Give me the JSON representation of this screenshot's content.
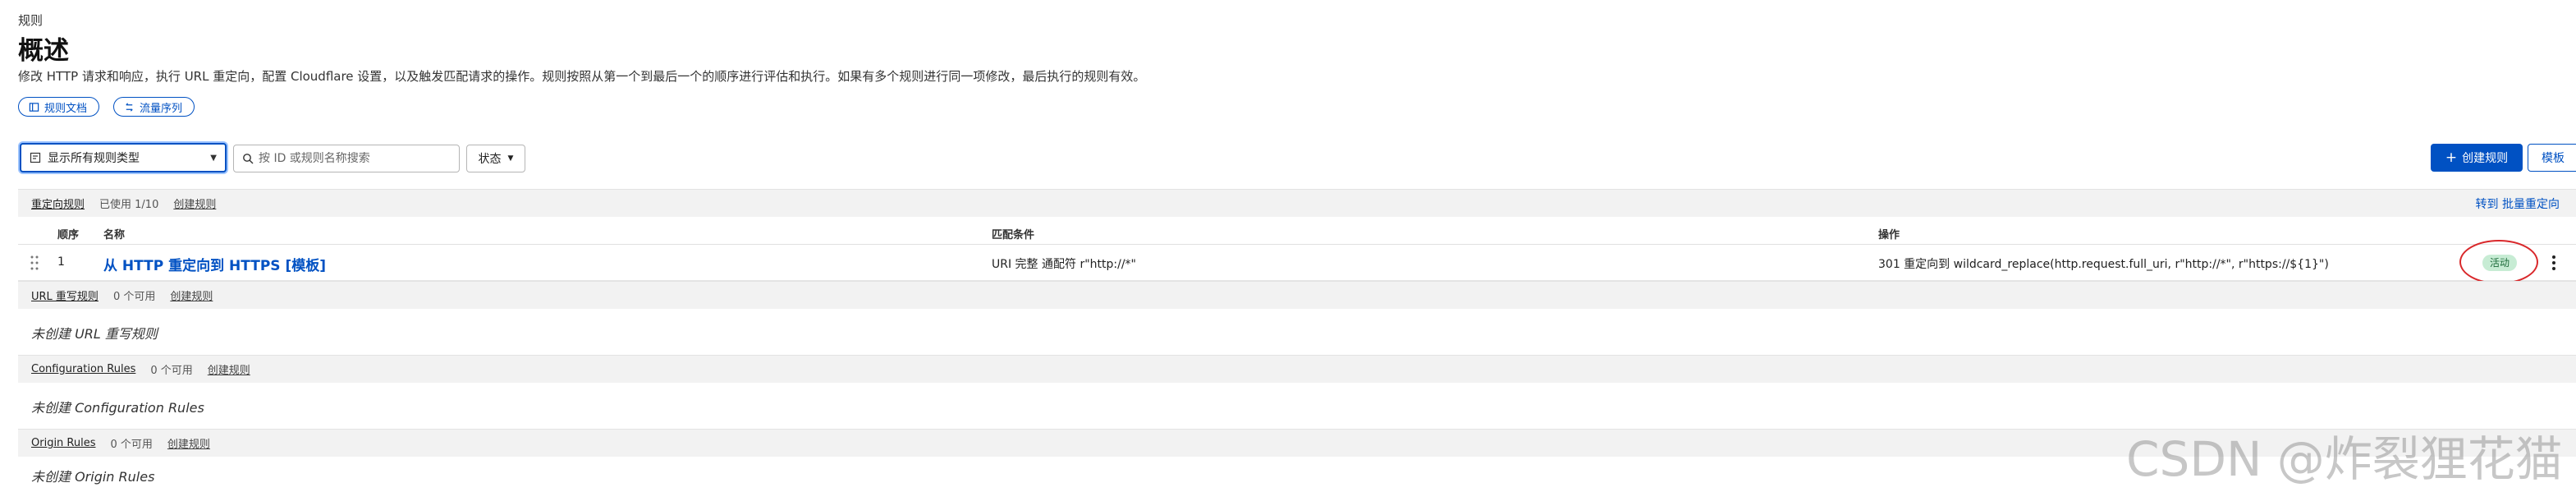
{
  "header": {
    "breadcrumb": "规则",
    "title": "概述",
    "description": "修改 HTTP 请求和响应，执行 URL 重定向，配置 Cloudflare 设置，以及触发匹配请求的操作。规则按照从第一个到最后一个的顺序进行评估和执行。如果有多个规则进行同一项修改，最后执行的规则有效。",
    "docs_label": "规则文档",
    "sequence_label": "流量序列"
  },
  "toolbar": {
    "type_select_value": "显示所有规则类型",
    "search_placeholder": "按 ID 或规则名称搜索",
    "status_label": "状态",
    "create_label": "创建规则",
    "template_label": "模板"
  },
  "sections": {
    "redirect": {
      "name": "重定向规则",
      "count": "已使用 1/10",
      "create": "创建规则",
      "bulk_link": "转到 批量重定向",
      "columns": [
        "顺序",
        "名称",
        "匹配条件",
        "操作"
      ],
      "rule": {
        "order": "1",
        "name": "从 HTTP 重定向到 HTTPS [模板]",
        "match": "URI 完整 通配符 r\"http://*\"",
        "action": "301 重定向到 wildcard_replace(http.request.full_uri, r\"http://*\", r\"https://${1}\")",
        "status": "活动"
      }
    },
    "url_rewrite": {
      "name": "URL 重写规则",
      "count": "0 个可用",
      "create": "创建规则",
      "empty": "未创建 URL 重写规则"
    },
    "configuration": {
      "name": "Configuration Rules",
      "count": "0 个可用",
      "create": "创建规则",
      "empty": "未创建 Configuration Rules"
    },
    "origin": {
      "name": "Origin Rules",
      "count": "0 个可用",
      "create": "创建规则",
      "empty": "未创建 Origin Rules"
    }
  },
  "watermark": "CSDN @炸裂狸花猫",
  "colors": {
    "accent": "#0051c3",
    "active_badge_bg": "#c7ecd4",
    "active_badge_text": "#1d6b3a",
    "annotation_red": "#d9282b",
    "section_bg": "#f2f2f2"
  }
}
